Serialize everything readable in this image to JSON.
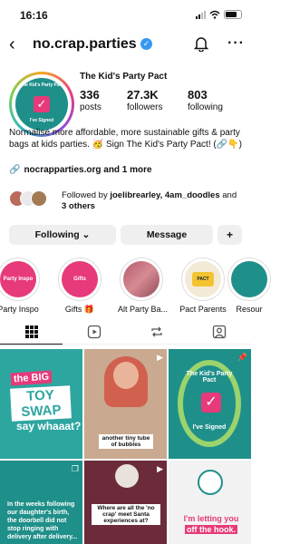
{
  "status_bar": {
    "time": "16:16"
  },
  "profile": {
    "username": "no.crap.parties",
    "full_name": "The Kid's Party Pact",
    "avatar_text_top": "The Kid's Party Pact",
    "avatar_text_bottom": "I've Signed",
    "stats": [
      {
        "value": "336",
        "label": "posts"
      },
      {
        "value": "27.3K",
        "label": "followers"
      },
      {
        "value": "803",
        "label": "following"
      }
    ],
    "bio": "Normalise more affordable, more sustainable gifts & party bags at kids parties. 🥳 Sign The Kid's Party Pact! (🔗👇)",
    "link": "nocrapparties.org and 1 more",
    "followed_by_prefix": "Followed by ",
    "followed_by_names": "joelibrearley, 4am_doodles",
    "followed_by_and": " and ",
    "followed_by_others": "3 others"
  },
  "buttons": {
    "following": "Following ⌄",
    "message": "Message",
    "add_person": "+"
  },
  "highlights": [
    {
      "label": "Party Inspo",
      "inner": "Party Inspo"
    },
    {
      "label": "Gifts 🎁",
      "inner": "Gifts"
    },
    {
      "label": "Alt Party Ba...",
      "inner": ""
    },
    {
      "label": "Pact Parents",
      "inner": "PACT"
    },
    {
      "label": "Resour",
      "inner": ""
    }
  ],
  "tabs": [
    "grid",
    "reels",
    "reposts",
    "tagged"
  ],
  "posts": {
    "p1_big": "the BIG",
    "p1_toy": "TOY SWAP",
    "p1_say": "say whaaat?",
    "p2_caption": "another tiny tube of bubbles",
    "p3_top": "The Kid's Party Pact",
    "p3_bottom": "I've Signed",
    "p4_text": "In the weeks following our daughter's birth, the doorbell did not stop ringing with delivery after delivery...",
    "p5_caption": "Where are all the 'no crap' meet Santa experiences at?",
    "p6_line1": "I'm letting you",
    "p6_line2": "off the hook."
  },
  "colors": {
    "brand_pink": "#e63a7a",
    "brand_teal": "#1f8f8a",
    "verified_blue": "#3897f0"
  }
}
